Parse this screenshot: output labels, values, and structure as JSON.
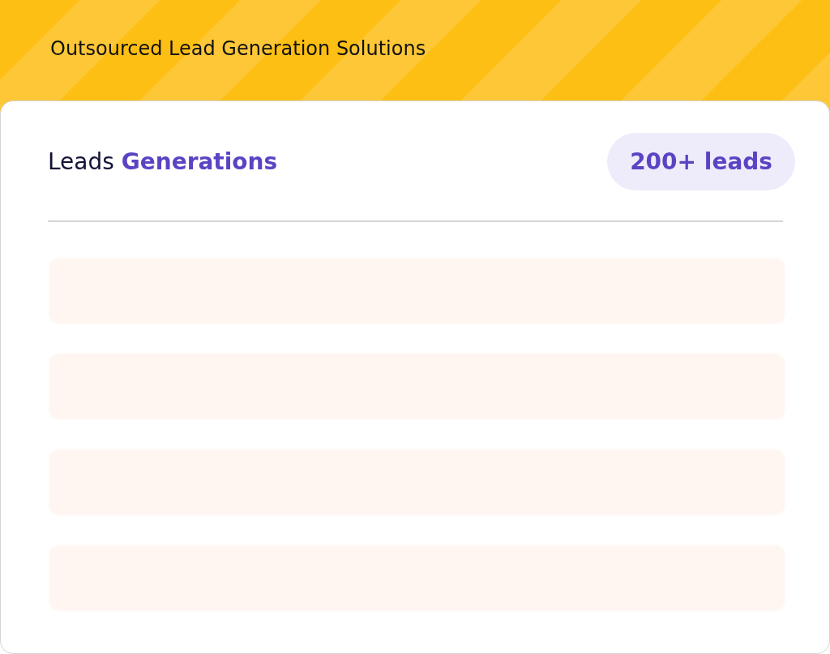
{
  "banner": {
    "title": "Outsourced Lead Generation Solutions"
  },
  "card": {
    "heading": {
      "text": "Leads",
      "highlight": "Generations"
    },
    "badge": "200+ leads",
    "rows": [
      {
        "kind": "blank"
      },
      {
        "kind": "blank"
      },
      {
        "kind": "blank"
      },
      {
        "kind": "blank"
      }
    ]
  }
}
